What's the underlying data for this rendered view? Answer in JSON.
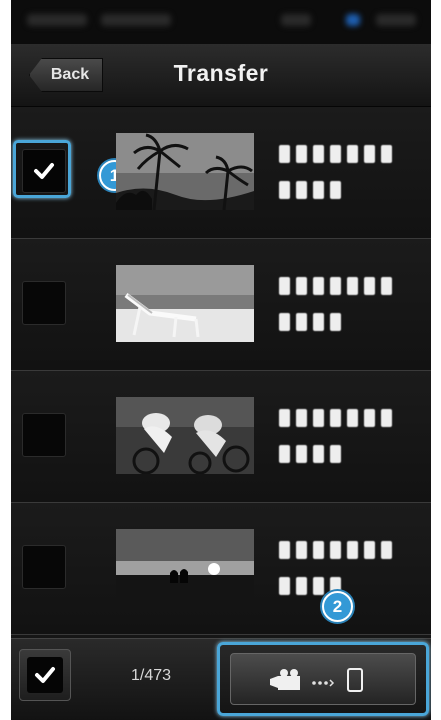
{
  "header": {
    "title": "Transfer",
    "back_label": "Back"
  },
  "items": [
    {
      "checked": true,
      "thumbnail": "palm-trees-photo"
    },
    {
      "checked": false,
      "thumbnail": "beach-chair-photo"
    },
    {
      "checked": false,
      "thumbnail": "cyclists-photo"
    },
    {
      "checked": false,
      "thumbnail": "sunset-couple-photo"
    }
  ],
  "callouts": {
    "first": "1",
    "second": "2"
  },
  "footer": {
    "counter": "1/473",
    "transfer_icon": "camera-to-phone-icon",
    "select_all_icon": "checkmark-icon"
  },
  "colors": {
    "highlight": "#4aa6d8",
    "callout": "#3399d6"
  }
}
